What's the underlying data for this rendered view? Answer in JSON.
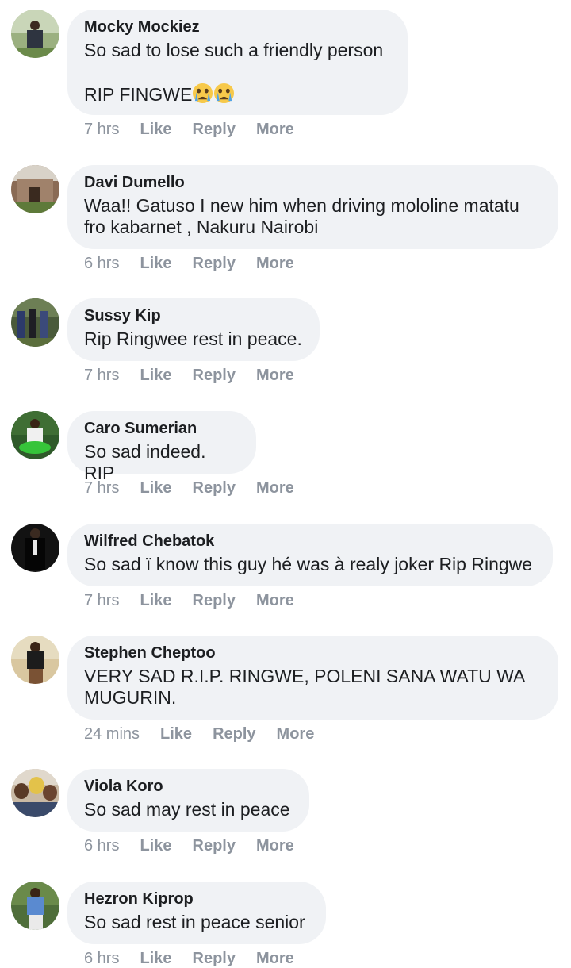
{
  "actions": {
    "like": "Like",
    "reply": "Reply",
    "more": "More"
  },
  "colors": {
    "bubble_bg": "#f0f2f5",
    "author_text": "#1c1e21",
    "meta_text": "#8d949e"
  },
  "comments": [
    {
      "author": "Mocky Mockiez",
      "text": "So sad to lose such a friendly person\n\nRIP FINGWE",
      "emoji": [
        "crying-face-icon",
        "crying-face-icon"
      ],
      "time": "7 hrs",
      "avatar_icon": "profile-photo-avatar"
    },
    {
      "author": "Davi Dumello",
      "text": "Waa!! Gatuso I new him when driving mololine matatu fro kabarnet , Nakuru Nairobi",
      "time": "6 hrs",
      "avatar_icon": "profile-photo-avatar"
    },
    {
      "author": "Sussy Kip",
      "text": "Rip Ringwee rest in peace.",
      "time": "7 hrs",
      "avatar_icon": "profile-photo-avatar"
    },
    {
      "author": "Caro Sumerian",
      "text": "So sad indeed. RIP",
      "time": "7 hrs",
      "avatar_icon": "profile-photo-avatar"
    },
    {
      "author": "Wilfred Chebatok",
      "text": "So sad ï know this guy hé was à realy joker Rip Ringwe",
      "time": "7 hrs",
      "avatar_icon": "profile-photo-avatar"
    },
    {
      "author": "Stephen Cheptoo",
      "text": "VERY SAD R.I.P. RINGWE, POLENI SANA WATU WA MUGURIN.",
      "time": "24 mins",
      "avatar_icon": "profile-photo-avatar"
    },
    {
      "author": "Viola Koro",
      "text": "So sad may rest in peace",
      "time": "6 hrs",
      "avatar_icon": "profile-photo-avatar"
    },
    {
      "author": "Hezron Kiprop",
      "text": "So sad rest in peace senior",
      "time": "6 hrs",
      "avatar_icon": "profile-photo-avatar"
    }
  ]
}
